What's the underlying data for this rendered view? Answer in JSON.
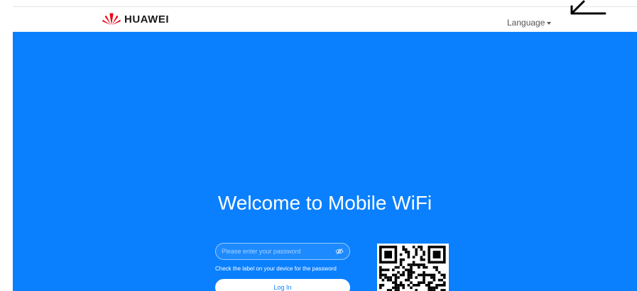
{
  "header": {
    "brand": "HUAWEI",
    "language_label": "Language"
  },
  "hero": {
    "title": "Welcome to Mobile WiFi",
    "bg_color": "#0a80ff"
  },
  "login": {
    "password_placeholder": "Please enter your password",
    "password_value": "",
    "hint": "Check the label on your device for the password",
    "login_label": "Log In"
  },
  "icons": {
    "logo": "huawei-petal-logo",
    "language_caret": "caret-down-icon",
    "password_visibility": "eye-hidden-icon",
    "qr": "qr-code",
    "annotation": "arrow-annotation"
  },
  "colors": {
    "brand_red": "#e60012",
    "accent": "#0a80ff",
    "header_bg": "#ffffff"
  }
}
